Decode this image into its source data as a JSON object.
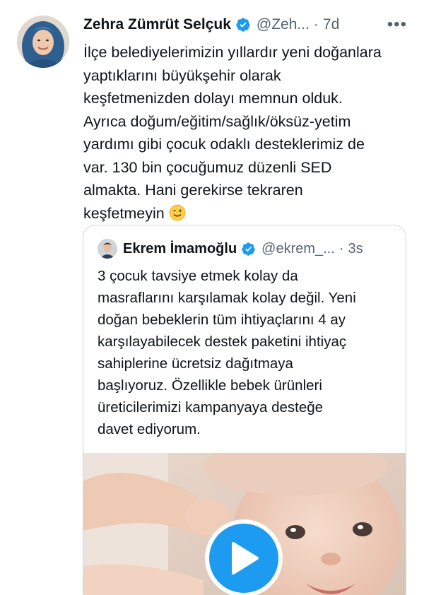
{
  "tweet": {
    "author_name": "Zehra Zümrüt Selçuk",
    "handle": "@Zeh...",
    "separator": "·",
    "time": "7d",
    "more": "•••",
    "lines": [
      "İlçe belediyelerimizin yıllardır yeni doğanlara",
      "yaptıklarını büyükşehir olarak",
      "keşfetmenizden dolayı memnun olduk.",
      "Ayrıca doğum/eğitim/sağlık/öksüz-yetim",
      "yardımı gibi çocuk odaklı desteklerimiz de",
      "var. 130 bin çocuğumuz düzenli SED",
      "almakta. Hani gerekirse tekraren",
      "keşfetmeyin"
    ],
    "emoji_icon": "winking-face-emoji"
  },
  "quoted": {
    "author_name": "Ekrem İmamoğlu",
    "handle": "@ekrem_...",
    "separator": "·",
    "time": "3s",
    "lines": [
      "3 çocuk tavsiye etmek kolay da",
      "masraflarını karşılamak kolay değil. Yeni",
      "doğan bebeklerin tüm ihtiyaçlarını 4 ay",
      "karşılayabilecek destek paketini ihtiyaç",
      "sahiplerine ücretsiz dağıtmaya",
      "başlıyoruz. Özellikle bebek ürünleri",
      "üreticilerimizi kampanyaya desteğe",
      "davet ediyorum."
    ],
    "media_icon": "play-icon"
  },
  "colors": {
    "verified_blue": "#1d9bf0",
    "secondary_text": "#536471",
    "border": "#cfd9de"
  }
}
